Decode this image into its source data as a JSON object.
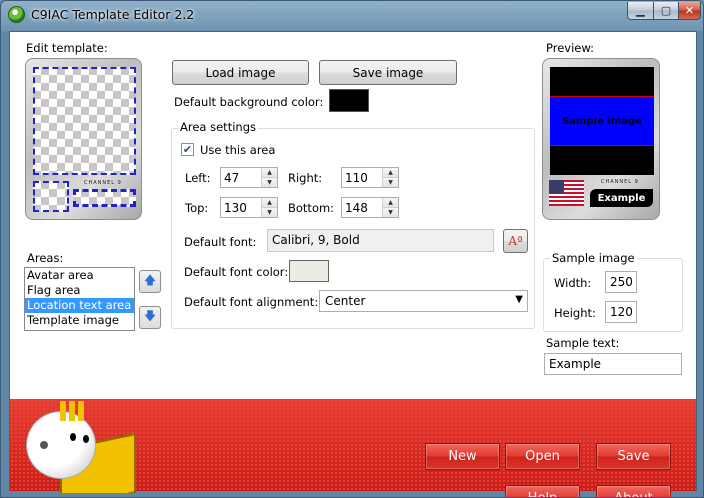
{
  "window": {
    "title": "C9IAC Template Editor 2.2"
  },
  "editor": {
    "edit_template_label": "Edit template:",
    "load_image": "Load image",
    "save_image": "Save image",
    "bg_color_label": "Default background color:",
    "bg_color": "#000000",
    "card_channel_text": "CHANNEL 9"
  },
  "area_settings": {
    "title": "Area settings",
    "use_area_label": "Use this area",
    "use_area_checked": true,
    "left_label": "Left:",
    "left": "47",
    "right_label": "Right:",
    "right": "110",
    "top_label": "Top:",
    "top": "130",
    "bottom_label": "Bottom:",
    "bottom": "148",
    "font_label": "Default font:",
    "font_value": "Calibri, 9, Bold",
    "font_color_label": "Default font color:",
    "font_color": "#ecece4",
    "font_align_label": "Default font alignment:",
    "font_align": "Center"
  },
  "areas": {
    "label": "Areas:",
    "items": [
      "Avatar area",
      "Flag area",
      "Location text area",
      "Template image"
    ],
    "selected_index": 2
  },
  "preview": {
    "label": "Preview:",
    "sample_text": "Sample image",
    "channel_text": "CHANNEL 9",
    "badge_text": "Example"
  },
  "sample_image": {
    "title": "Sample image",
    "width_label": "Width:",
    "width": "250",
    "height_label": "Height:",
    "height": "120"
  },
  "sample_text": {
    "label": "Sample text:",
    "value": "Example"
  },
  "footer": {
    "new": "New",
    "open": "Open",
    "save": "Save",
    "help": "Help",
    "about": "About"
  },
  "colors": {
    "accent": "#3399ff",
    "footer_red": "#d62a22"
  }
}
